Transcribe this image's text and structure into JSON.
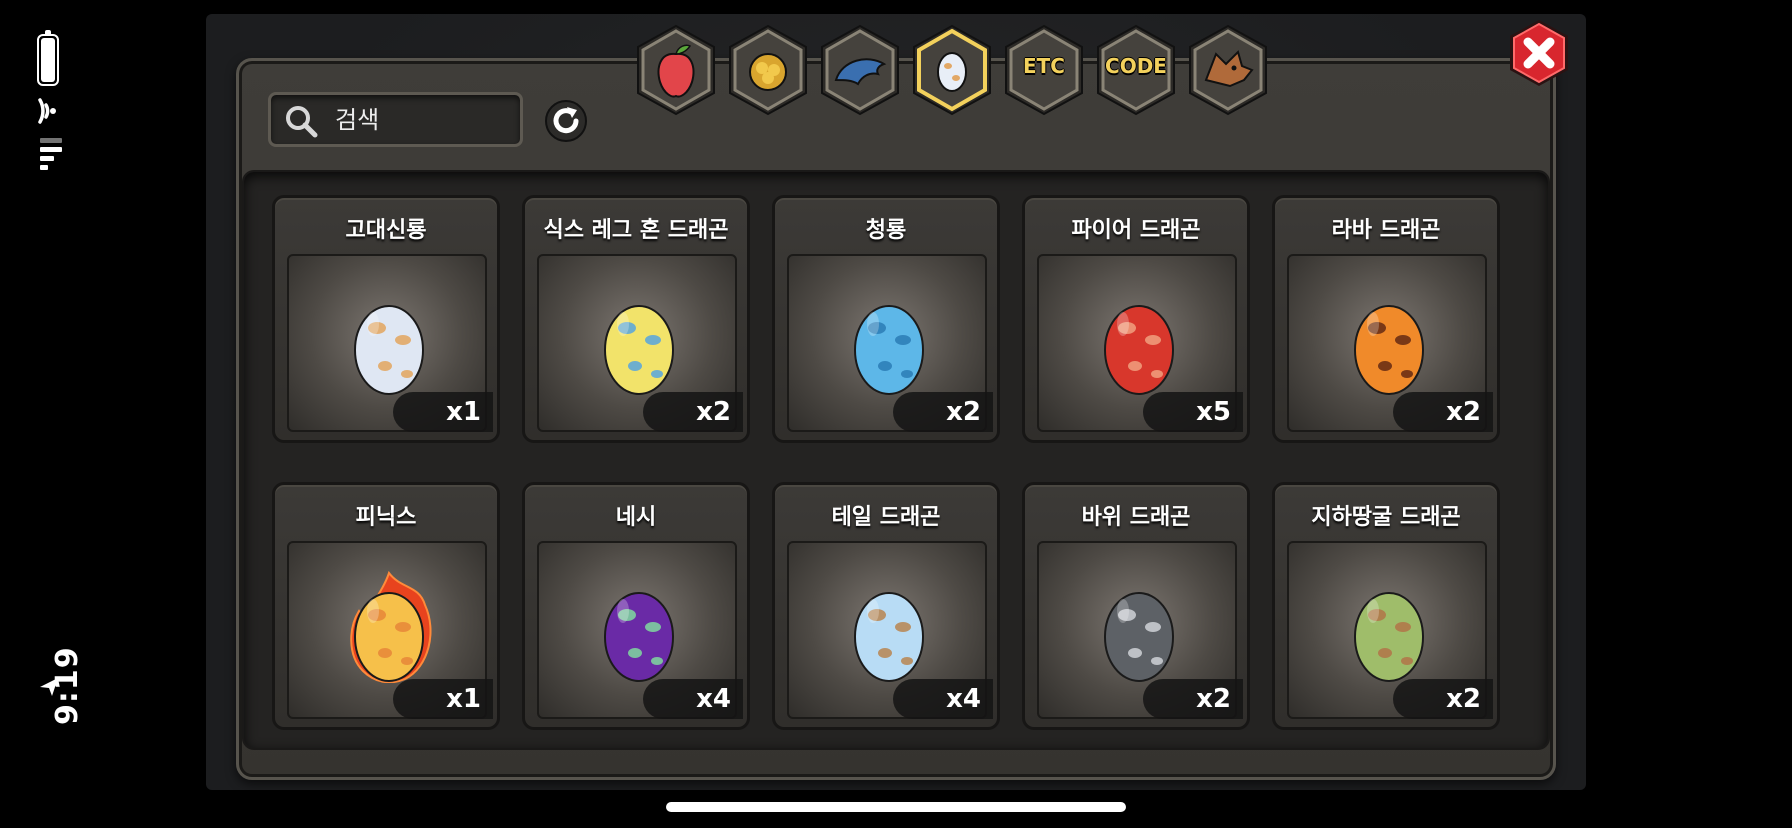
{
  "status": {
    "time": "9:19"
  },
  "tabs": [
    {
      "id": "fruit",
      "icon": "fruit-icon",
      "label": ""
    },
    {
      "id": "gold",
      "icon": "gold-coins-icon",
      "label": ""
    },
    {
      "id": "dragon-claw",
      "icon": "dragon-claw-icon",
      "label": ""
    },
    {
      "id": "egg",
      "icon": "egg-icon",
      "label": "",
      "active": true
    },
    {
      "id": "etc",
      "icon": "",
      "label": "ETC"
    },
    {
      "id": "code",
      "icon": "",
      "label": "CODE"
    },
    {
      "id": "dragon-head",
      "icon": "dragon-head-icon",
      "label": ""
    }
  ],
  "search": {
    "placeholder": "검색"
  },
  "items": [
    {
      "name": "고대신룡",
      "count": "x1",
      "egg": {
        "base": "#dfe7f3",
        "spot": "#e2a866"
      }
    },
    {
      "name": "식스 레그 혼 드래곤",
      "count": "x2",
      "egg": {
        "base": "#f2e36a",
        "spot": "#5fa7d8"
      }
    },
    {
      "name": "청룡",
      "count": "x2",
      "egg": {
        "base": "#5db7e8",
        "spot": "#2e7fb8"
      }
    },
    {
      "name": "파이어 드래곤",
      "count": "x5",
      "egg": {
        "base": "#d8372c",
        "spot": "#f09a7a"
      }
    },
    {
      "name": "라바 드래곤",
      "count": "x2",
      "egg": {
        "base": "#f08a2a",
        "spot": "#6b2f14"
      }
    },
    {
      "name": "피닉스",
      "count": "x1",
      "egg": {
        "base": "#f6c04a",
        "spot": "#e88a3a"
      },
      "flame": true
    },
    {
      "name": "네시",
      "count": "x4",
      "egg": {
        "base": "#6a2aa6",
        "spot": "#7ecfa0"
      }
    },
    {
      "name": "테일 드래곤",
      "count": "x4",
      "egg": {
        "base": "#b8dcf5",
        "spot": "#b88a5a"
      }
    },
    {
      "name": "바위 드래곤",
      "count": "x2",
      "egg": {
        "base": "#5d6166",
        "spot": "#c9ccd0"
      }
    },
    {
      "name": "지하땅굴 드래곤",
      "count": "x2",
      "egg": {
        "base": "#9fbd6a",
        "spot": "#b0784a"
      }
    }
  ],
  "colors": {
    "accent": "#f3d15c",
    "close_red": "#d8262e"
  }
}
